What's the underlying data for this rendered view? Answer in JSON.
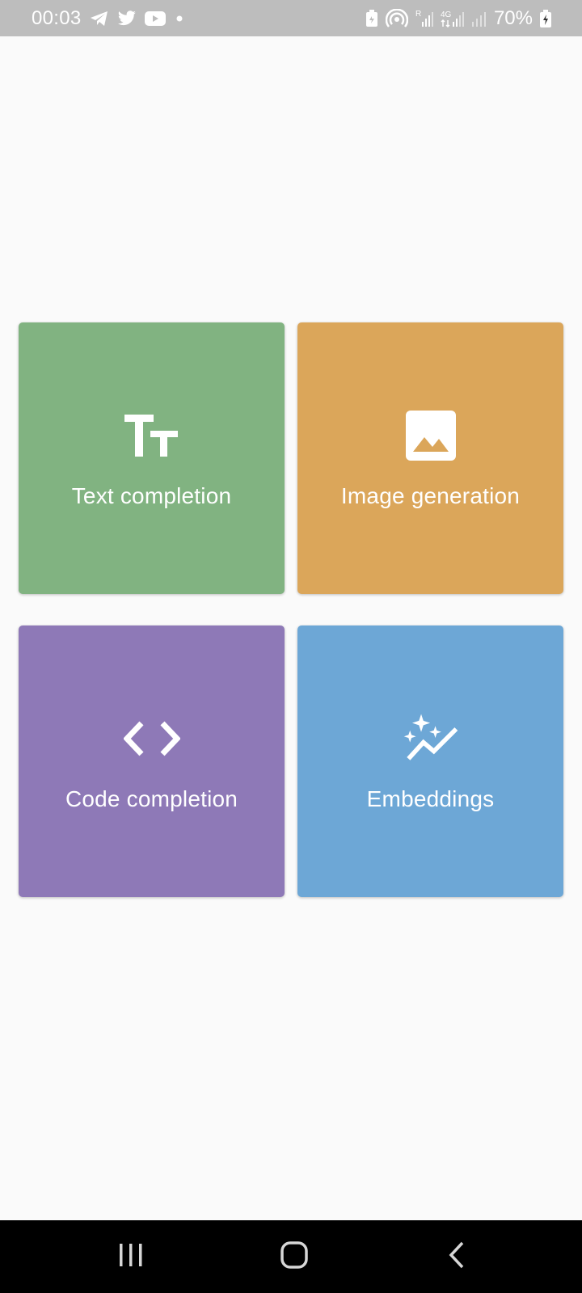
{
  "status_bar": {
    "time": "00:03",
    "battery_percent": "70%",
    "network_label": "4G",
    "roaming_label": "R",
    "notification_icons": [
      "telegram-icon",
      "twitter-icon",
      "youtube-icon",
      "dot-icon"
    ],
    "system_icons": [
      "battery-saver-icon",
      "hotspot-icon",
      "signal-roaming-icon",
      "signal-4g-icon",
      "signal-icon",
      "battery-charging-icon"
    ]
  },
  "tiles": [
    {
      "label": "Text completion",
      "icon": "text-fields-icon",
      "color": "#81b381"
    },
    {
      "label": "Image generation",
      "icon": "image-icon",
      "color": "#dba65a"
    },
    {
      "label": "Code completion",
      "icon": "code-icon",
      "color": "#8e79b7"
    },
    {
      "label": "Embeddings",
      "icon": "auto-graph-icon",
      "color": "#6da7d6"
    }
  ],
  "nav_bar": {
    "buttons": [
      "recents-icon",
      "home-icon",
      "back-icon"
    ]
  },
  "colors": {
    "background": "#fafafa",
    "status_bar": "#bdbdbd",
    "nav_bar": "#000000"
  }
}
